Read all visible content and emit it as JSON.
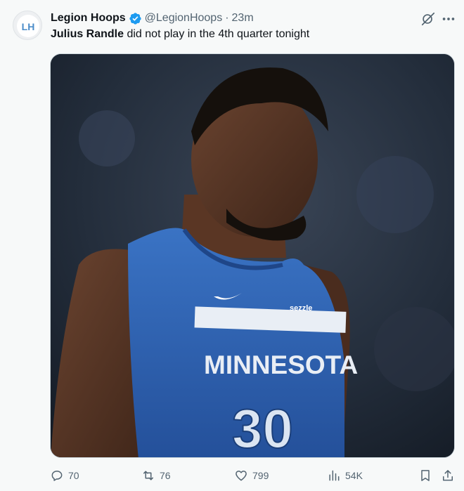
{
  "author": {
    "name": "Legion Hoops",
    "handle": "@LegionHoops",
    "separator": "·",
    "time": "23m",
    "avatar_letters": "LH"
  },
  "tweet": {
    "bold_text": "Julius Randle",
    "rest_text": " did not play in the 4th quarter tonight"
  },
  "image": {
    "jersey_text": "MINNESOTA",
    "jersey_number": "30",
    "sponsor": "sezzle"
  },
  "actions": {
    "replies": "70",
    "reposts": "76",
    "likes": "799",
    "views": "54K"
  },
  "icons": {
    "verified": "verified-badge-icon",
    "grok": "grok-icon",
    "more": "more-icon",
    "reply": "reply-icon",
    "repost": "repost-icon",
    "like": "heart-icon",
    "views": "views-icon",
    "bookmark": "bookmark-icon",
    "share": "share-icon"
  },
  "colors": {
    "verified": "#1d9bf0",
    "muted_text": "#536471",
    "jersey_blue": "#2f64b3"
  }
}
